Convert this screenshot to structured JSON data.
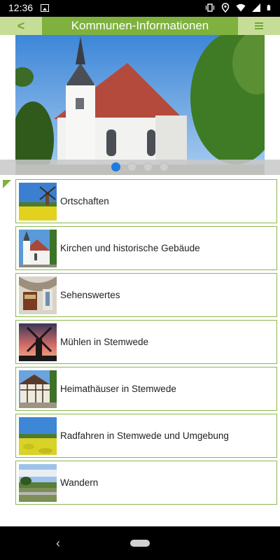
{
  "status_bar": {
    "time": "12:36"
  },
  "header": {
    "back_label": "<",
    "title": "Kommunen-Informationen"
  },
  "carousel": {
    "active_index": 0,
    "page_count": 4
  },
  "items": [
    {
      "label": "Ortschaften",
      "thumb": "windmill-field-thumb"
    },
    {
      "label": "Kirchen und historische Gebäude",
      "thumb": "church-thumb"
    },
    {
      "label": "Sehenswertes",
      "thumb": "interior-thumb"
    },
    {
      "label": "Mühlen in Stemwede",
      "thumb": "windmill-sunset-thumb"
    },
    {
      "label": "Heimathäuser in Stemwede",
      "thumb": "timber-house-thumb"
    },
    {
      "label": "Radfahren in Stemwede und Umgebung",
      "thumb": "rapeseed-field-thumb"
    },
    {
      "label": "Wandern",
      "thumb": "landscape-thumb"
    }
  ],
  "colors": {
    "accent": "#7fb13e",
    "header_light": "#c6dd98",
    "dot_active": "#1e7be3"
  }
}
